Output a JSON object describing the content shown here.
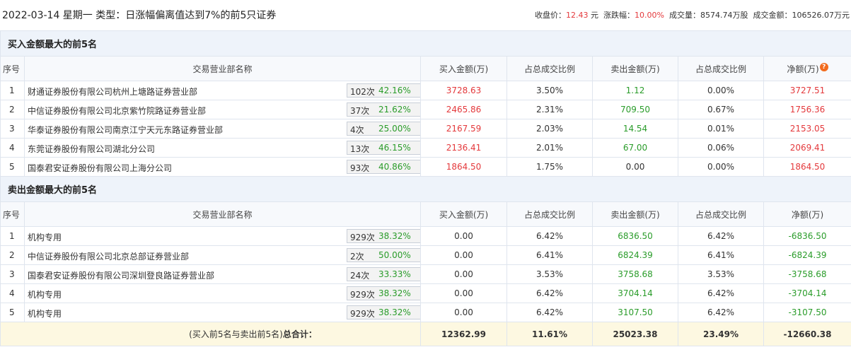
{
  "header": {
    "title": "2022-03-14 星期一 类型：日涨幅偏离值达到7%的前5只证券",
    "close_label": "收盘价：",
    "close_value": "12.43",
    "close_unit": "元",
    "change_label": "涨跌幅：",
    "change_value": "10.00%",
    "volume_label": "成交量：",
    "volume_value": "8574.74万股",
    "amount_label": "成交金额：",
    "amount_value": "106526.07万元"
  },
  "columns": {
    "seq": "序号",
    "name": "交易营业部名称",
    "buy": "买入金额(万)",
    "buy_ratio": "占总成交比例",
    "sell": "卖出金额(万)",
    "sell_ratio": "占总成交比例",
    "net_top": "净额(万)",
    "net_bottom": "净额(万)",
    "help_glyph": "?"
  },
  "buy_section": {
    "title": "买入金额最大的前5名",
    "rows": [
      {
        "seq": "1",
        "name": "财通证券股份有限公司杭州上塘路证券营业部",
        "count": "102次",
        "pct": "42.16%",
        "icon": "question-icon",
        "buy": "3728.63",
        "buy_ratio": "3.50%",
        "sell": "1.12",
        "sell_ratio": "0.00%",
        "net": "3727.51"
      },
      {
        "seq": "2",
        "name": "中信证券股份有限公司北京紫竹院路证券营业部",
        "count": "37次",
        "pct": "21.62%",
        "icon": "arrow-right-icon",
        "buy": "2465.86",
        "buy_ratio": "2.31%",
        "sell": "709.50",
        "sell_ratio": "0.67%",
        "net": "1756.36"
      },
      {
        "seq": "3",
        "name": "华泰证券股份有限公司南京江宁天元东路证券营业部",
        "count": "4次",
        "pct": "25.00%",
        "icon": "arrow-right-icon",
        "buy": "2167.59",
        "buy_ratio": "2.03%",
        "sell": "14.54",
        "sell_ratio": "0.01%",
        "net": "2153.05"
      },
      {
        "seq": "4",
        "name": "东莞证券股份有限公司湖北分公司",
        "count": "13次",
        "pct": "46.15%",
        "icon": "arrow-right-icon",
        "buy": "2136.41",
        "buy_ratio": "2.01%",
        "sell": "67.00",
        "sell_ratio": "0.06%",
        "net": "2069.41"
      },
      {
        "seq": "5",
        "name": "国泰君安证券股份有限公司上海分公司",
        "count": "93次",
        "pct": "40.86%",
        "icon": "arrow-right-icon",
        "buy": "1864.50",
        "buy_ratio": "1.75%",
        "sell": "0.00",
        "sell_ratio": "0.00%",
        "net": "1864.50"
      }
    ]
  },
  "sell_section": {
    "title": "卖出金额最大的前5名",
    "rows": [
      {
        "seq": "1",
        "name": "机构专用",
        "count": "929次",
        "pct": "38.32%",
        "icon": "question-icon",
        "buy": "0.00",
        "buy_ratio": "6.42%",
        "sell": "6836.50",
        "sell_ratio": "6.42%",
        "net": "-6836.50"
      },
      {
        "seq": "2",
        "name": "中信证券股份有限公司北京总部证券营业部",
        "count": "2次",
        "pct": "50.00%",
        "icon": "arrow-right-icon",
        "buy": "0.00",
        "buy_ratio": "6.41%",
        "sell": "6824.39",
        "sell_ratio": "6.41%",
        "net": "-6824.39"
      },
      {
        "seq": "3",
        "name": "国泰君安证券股份有限公司深圳登良路证券营业部",
        "count": "24次",
        "pct": "33.33%",
        "icon": "arrow-right-icon",
        "buy": "0.00",
        "buy_ratio": "3.53%",
        "sell": "3758.68",
        "sell_ratio": "3.53%",
        "net": "-3758.68"
      },
      {
        "seq": "4",
        "name": "机构专用",
        "count": "929次",
        "pct": "38.32%",
        "icon": "arrow-right-icon",
        "buy": "0.00",
        "buy_ratio": "6.42%",
        "sell": "3704.14",
        "sell_ratio": "6.42%",
        "net": "-3704.14"
      },
      {
        "seq": "5",
        "name": "机构专用",
        "count": "929次",
        "pct": "38.32%",
        "icon": "arrow-right-icon",
        "buy": "0.00",
        "buy_ratio": "6.42%",
        "sell": "3107.50",
        "sell_ratio": "6.42%",
        "net": "-3107.50"
      }
    ]
  },
  "total": {
    "label_prefix": "(买入前5名与卖出前5名)",
    "label_suffix": "总合计：",
    "buy": "12362.99",
    "buy_ratio": "11.61%",
    "sell": "25023.38",
    "sell_ratio": "23.49%",
    "net": "-12660.38"
  },
  "colors": {
    "positive": "#e4393c",
    "negative": "#2a9c2a",
    "section_bg": "#eef3fa",
    "total_bg": "#fdf8e1",
    "help_icon": "#f26b1d",
    "arrow_icon": "#2255aa"
  }
}
